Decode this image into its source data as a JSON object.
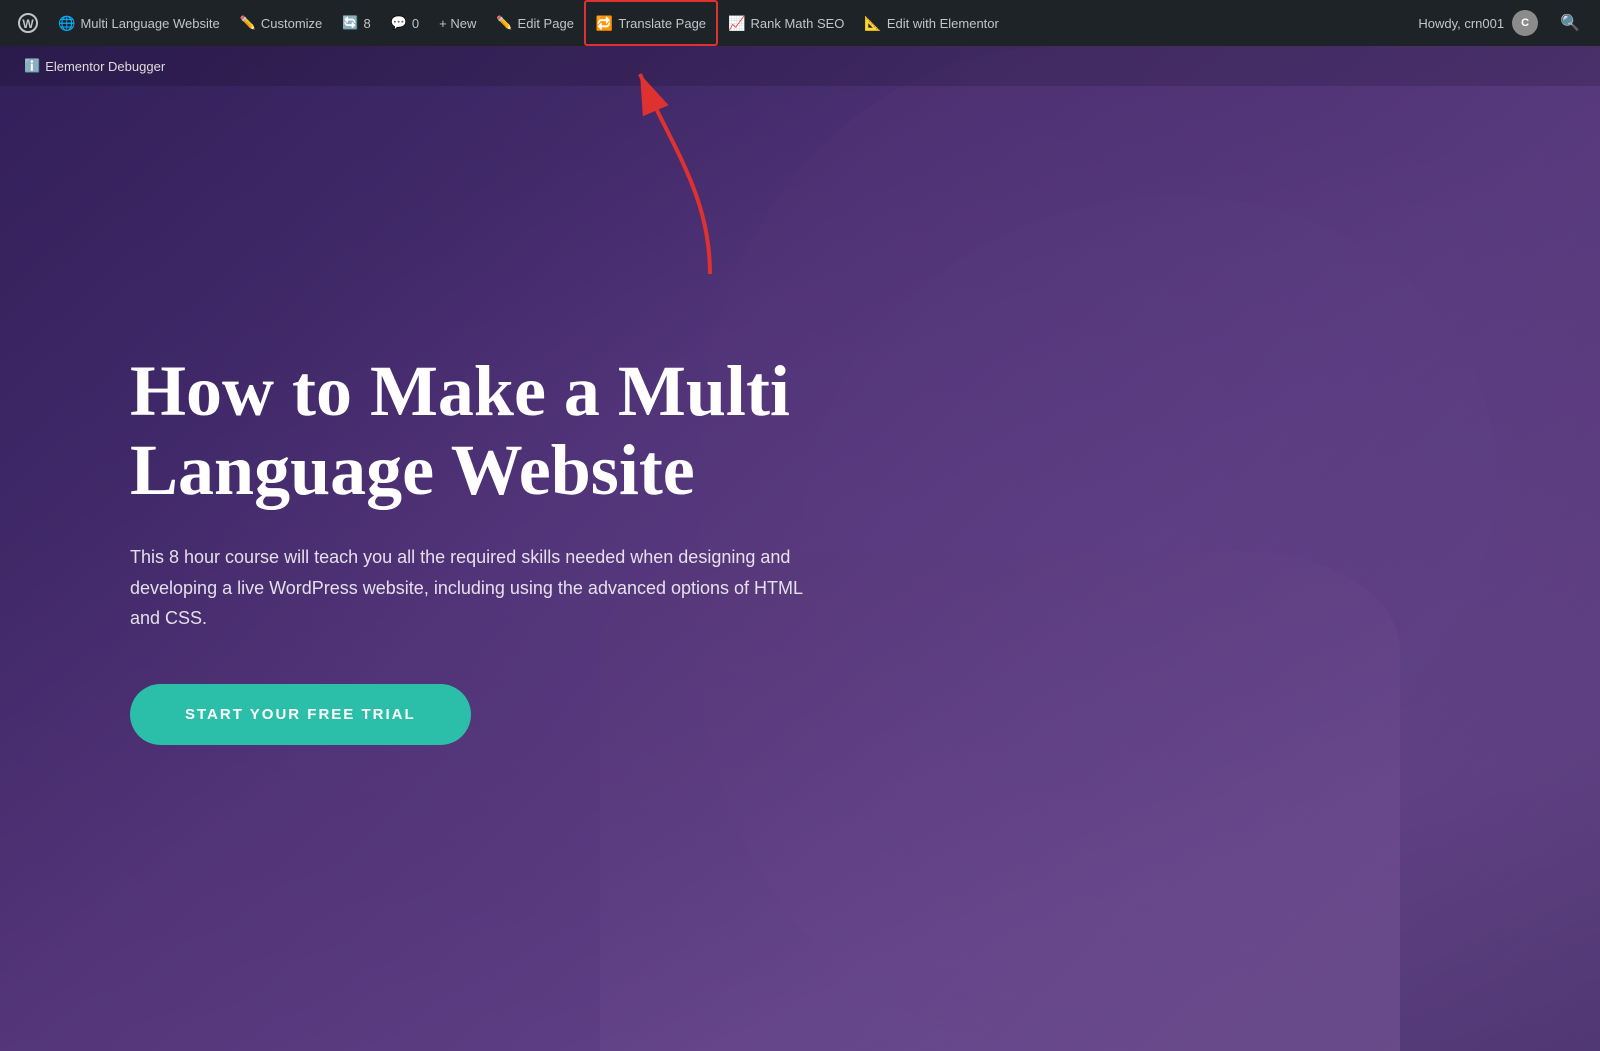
{
  "adminBar": {
    "wpLogo": "W",
    "siteName": "Multi Language Website",
    "customize": "Customize",
    "revisions": "8",
    "comments": "0",
    "new": "+ New",
    "editPage": "Edit Page",
    "translatePage": "Translate Page",
    "rankMath": "Rank Math SEO",
    "editWithElementor": "Edit with Elementor",
    "howdy": "Howdy, crn001",
    "avatarText": "C"
  },
  "subBar": {
    "debugger": "Elementor Debugger",
    "infoIcon": "ℹ"
  },
  "hero": {
    "title": "How to Make a Multi Language Website",
    "subtitle": "This 8 hour course will teach you all the required skills needed when designing and developing a live WordPress website, including using the advanced options of HTML and CSS.",
    "ctaLabel": "START YOUR FREE TRIAL"
  },
  "colors": {
    "adminBarBg": "#1d2327",
    "translatePageBorder": "#e03131",
    "ctaButton": "#2bbfaa",
    "heroOverlay": "rgba(40,20,80,0.72)"
  }
}
